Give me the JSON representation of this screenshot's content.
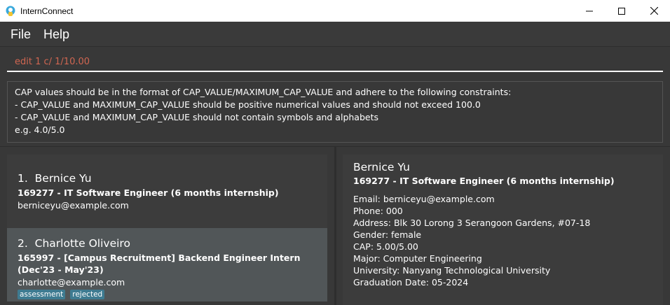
{
  "window": {
    "title": "InternConnect"
  },
  "menu": {
    "items": [
      "File",
      "Help"
    ]
  },
  "command": {
    "value": "edit 1 c/ 1/10.00"
  },
  "result": {
    "lines": [
      "CAP values should be in the format of CAP_VALUE/MAXIMUM_CAP_VALUE and adhere to the following constraints:",
      "- CAP_VALUE and MAXIMUM_CAP_VALUE should be positive numerical values and should not exceed 100.0",
      "- CAP_VALUE and MAXIMUM_CAP_VALUE should not contain symbols and alphabets",
      "e.g. 4.0/5.0"
    ]
  },
  "persons": [
    {
      "index": "1.",
      "name": "Bernice Yu",
      "job": "169277 - IT Software Engineer (6 months internship)",
      "email": "berniceyu@example.com",
      "tags": []
    },
    {
      "index": "2.",
      "name": "Charlotte Oliveiro",
      "job": "165997 - [Campus Recruitment] Backend Engineer Intern (Dec'23 - May'23)",
      "email": "charlotte@example.com",
      "tags": [
        "assessment",
        "rejected"
      ]
    }
  ],
  "detail": {
    "name": "Bernice Yu",
    "job": "169277 - IT Software Engineer (6 months internship)",
    "email": "Email: berniceyu@example.com",
    "phone": "Phone: 000",
    "address": "Address: Blk 30 Lorong 3 Serangoon Gardens, #07-18",
    "gender": "Gender: female",
    "cap": "CAP: 5.00/5.00",
    "major": "Major: Computer Engineering",
    "university": "University: Nanyang Technological University",
    "graduation": "Graduation Date: 05-2024"
  },
  "colors": {
    "command_text": "#d06651",
    "tag_bg": "#3e7b91",
    "selected_card": "#515658"
  }
}
